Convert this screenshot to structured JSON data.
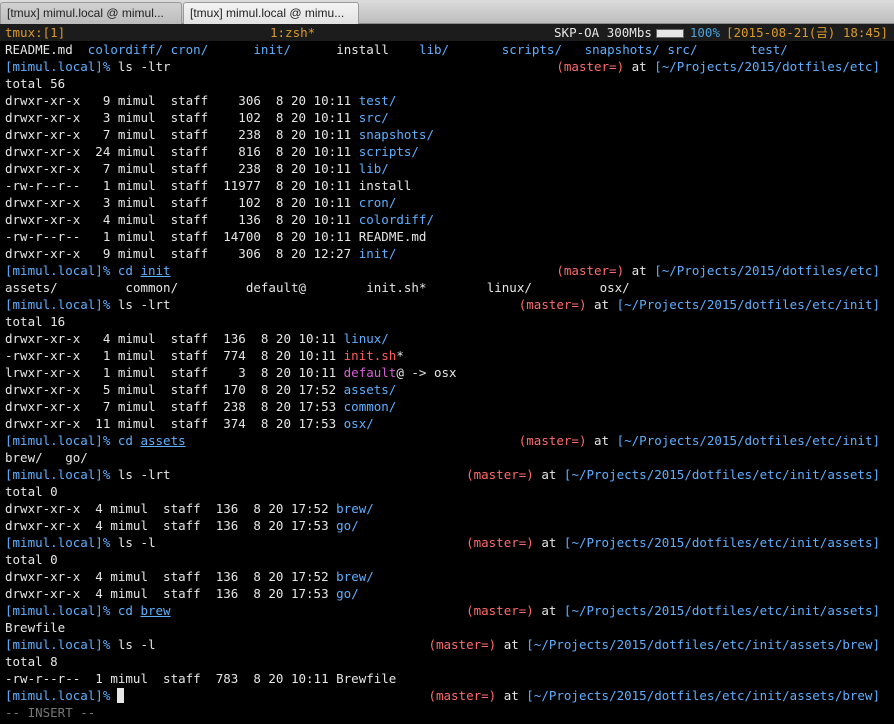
{
  "tabs": [
    {
      "title": "[tmux] mimul.local @ mimul..."
    },
    {
      "title": "[tmux] mimul.local @ mimu..."
    }
  ],
  "status": {
    "session": "tmux:[1]",
    "window": "1:zsh*",
    "wifi": "SKP-OA 300Mbs",
    "battery_level": 1.0,
    "battery": "100%",
    "datetime": "[2015-08-21(금) 18:45]"
  },
  "accent": {
    "orange": "#d99a26",
    "blue": "#5fafff",
    "magenta": "#d75fd7",
    "red": "#ff5f5f"
  },
  "lines": {
    "l1": {
      "e1": "README.md",
      "e2": "colordiff/",
      "e3": "cron/",
      "e4": "init/",
      "e5": "install",
      "e6": "lib/",
      "e7": "scripts/",
      "e8": "snapshots/",
      "e9": "src/",
      "e10": "test/"
    },
    "p2": {
      "user": "[mimul.local]%",
      "cmd": " ls -ltr",
      "git": "(master=)",
      "at": " at ",
      "path": "[~/Projects/2015/dotfiles/etc]"
    },
    "l3": "total 56",
    "l4": {
      "meta": "drwxr-xr-x   9 mimul  staff    306  8 20 10:11 ",
      "name": "test/"
    },
    "l5": {
      "meta": "drwxr-xr-x   3 mimul  staff    102  8 20 10:11 ",
      "name": "src/"
    },
    "l6": {
      "meta": "drwxr-xr-x   7 mimul  staff    238  8 20 10:11 ",
      "name": "snapshots/"
    },
    "l7": {
      "meta": "drwxr-xr-x  24 mimul  staff    816  8 20 10:11 ",
      "name": "scripts/"
    },
    "l8": {
      "meta": "drwxr-xr-x   7 mimul  staff    238  8 20 10:11 ",
      "name": "lib/"
    },
    "l9": {
      "meta": "-rw-r--r--   1 mimul  staff  11977  8 20 10:11 ",
      "name": "install"
    },
    "l10": {
      "meta": "drwxr-xr-x   3 mimul  staff    102  8 20 10:11 ",
      "name": "cron/"
    },
    "l11": {
      "meta": "drwxr-xr-x   4 mimul  staff    136  8 20 10:11 ",
      "name": "colordiff/"
    },
    "l12": {
      "meta": "-rw-r--r--   1 mimul  staff  14700  8 20 10:11 ",
      "name": "README.md"
    },
    "l13": {
      "meta": "drwxr-xr-x   9 mimul  staff    306  8 20 12:27 ",
      "name": "init/"
    },
    "p14": {
      "user": "[mimul.local]%",
      "cmd": "cd",
      "arg": "init",
      "git": "(master=)",
      "at": " at ",
      "path": "[~/Projects/2015/dotfiles/etc]"
    },
    "l15": {
      "e1": "assets/",
      "e2": "common/",
      "e3": "default@",
      "e4": "init.sh*",
      "e5": "linux/",
      "e6": "osx/"
    },
    "p16": {
      "user": "[mimul.local]%",
      "cmd": " ls -lrt",
      "git": "(master=)",
      "at": " at ",
      "path": "[~/Projects/2015/dotfiles/etc/init]"
    },
    "l17": "total 16",
    "l18": {
      "meta": "drwxr-xr-x   4 mimul  staff  136  8 20 10:11 ",
      "name": "linux/"
    },
    "l19": {
      "meta": "-rwxr-xr-x   1 mimul  staff  774  8 20 10:11 ",
      "name": "init.sh",
      "suffix": "*"
    },
    "l20": {
      "meta": "lrwxr-xr-x   1 mimul  staff    3  8 20 10:11 ",
      "name": "default",
      "suffix": "@ -> osx"
    },
    "l21": {
      "meta": "drwxr-xr-x   5 mimul  staff  170  8 20 17:52 ",
      "name": "assets/"
    },
    "l22": {
      "meta": "drwxr-xr-x   7 mimul  staff  238  8 20 17:53 ",
      "name": "common/"
    },
    "l23": {
      "meta": "drwxr-xr-x  11 mimul  staff  374  8 20 17:53 ",
      "name": "osx/"
    },
    "p24": {
      "user": "[mimul.local]%",
      "cmd": "cd",
      "arg": "assets",
      "git": "(master=)",
      "at": " at ",
      "path": "[~/Projects/2015/dotfiles/etc/init]"
    },
    "l25": {
      "e1": "brew/",
      "e2": "go/"
    },
    "p26": {
      "user": "[mimul.local]%",
      "cmd": " ls -lrt",
      "git": "(master=)",
      "at": " at ",
      "path": "[~/Projects/2015/dotfiles/etc/init/assets]"
    },
    "l27": "total 0",
    "l28": {
      "meta": "drwxr-xr-x  4 mimul  staff  136  8 20 17:52 ",
      "name": "brew/"
    },
    "l29": {
      "meta": "drwxr-xr-x  4 mimul  staff  136  8 20 17:53 ",
      "name": "go/"
    },
    "p30": {
      "user": "[mimul.local]%",
      "cmd": " ls -l",
      "git": "(master=)",
      "at": " at ",
      "path": "[~/Projects/2015/dotfiles/etc/init/assets]"
    },
    "l31": "total 0",
    "l32": {
      "meta": "drwxr-xr-x  4 mimul  staff  136  8 20 17:52 ",
      "name": "brew/"
    },
    "l33": {
      "meta": "drwxr-xr-x  4 mimul  staff  136  8 20 17:53 ",
      "name": "go/"
    },
    "p34": {
      "user": "[mimul.local]%",
      "cmd": "cd",
      "arg": "brew",
      "git": "(master=)",
      "at": " at ",
      "path": "[~/Projects/2015/dotfiles/etc/init/assets]"
    },
    "l35": "Brewfile",
    "p36": {
      "user": "[mimul.local]%",
      "cmd": " ls -l",
      "git": "(master=)",
      "at": " at ",
      "path": "[~/Projects/2015/dotfiles/etc/init/assets/brew]"
    },
    "l37": "total 8",
    "l38": "-rw-r--r--  1 mimul  staff  783  8 20 10:11 Brewfile",
    "p39": {
      "user": "[mimul.local]%",
      "git": "(master=)",
      "at": " at ",
      "path": "[~/Projects/2015/dotfiles/etc/init/assets/brew]"
    },
    "l40": "-- INSERT --"
  }
}
